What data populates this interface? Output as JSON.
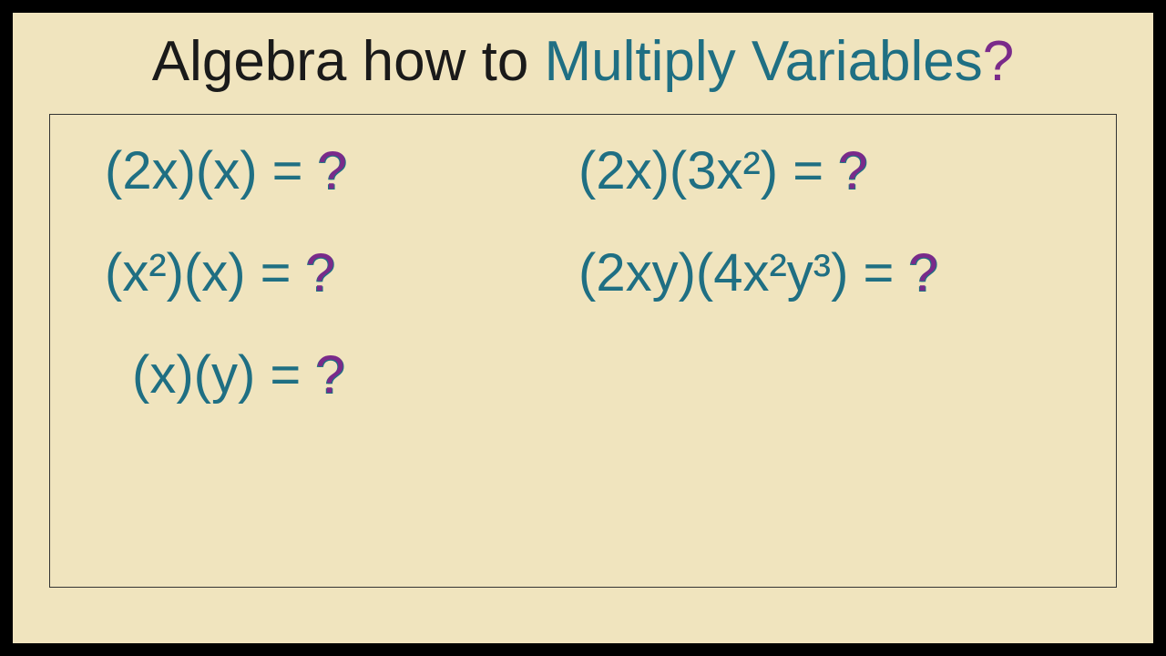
{
  "title": {
    "part1": "Algebra how to ",
    "part2": "Multiply Variables",
    "part3": "?"
  },
  "qmark": "?",
  "problems": {
    "p1": {
      "lhs": "(2x)(x) = "
    },
    "p2": {
      "lhs": "(2x)(3x²) = "
    },
    "p3": {
      "lhs": "(x²)(x) = "
    },
    "p4": {
      "lhs": "(2xy)(4x²y³) = "
    },
    "p5": {
      "lhs": "(x)(y) = "
    }
  }
}
